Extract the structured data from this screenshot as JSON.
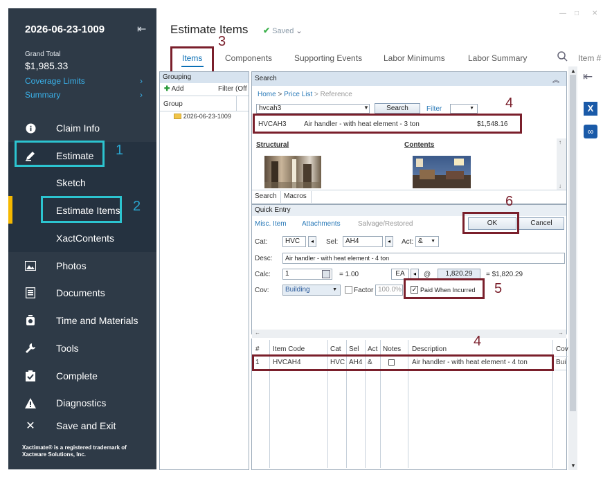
{
  "sidebar": {
    "title": "2026-06-23-1009",
    "grand_total_label": "Grand Total",
    "grand_total_value": "$1,985.33",
    "links": [
      "Coverage Limits",
      "Summary"
    ],
    "nav": [
      {
        "label": "Claim Info",
        "icon": "info-icon"
      },
      {
        "label": "Estimate",
        "icon": "pencil-icon"
      },
      {
        "label": "Sketch",
        "icon": ""
      },
      {
        "label": "Estimate Items",
        "icon": ""
      },
      {
        "label": "XactContents",
        "icon": ""
      },
      {
        "label": "Photos",
        "icon": "image-icon"
      },
      {
        "label": "Documents",
        "icon": "document-icon"
      },
      {
        "label": "Time and Materials",
        "icon": "stopwatch-icon"
      },
      {
        "label": "Tools",
        "icon": "wrench-icon"
      },
      {
        "label": "Complete",
        "icon": "clipboard-check-icon"
      },
      {
        "label": "Diagnostics",
        "icon": "warning-icon"
      },
      {
        "label": "Save and Exit",
        "icon": "close-icon"
      }
    ],
    "footer": "Xactimate® is a registered trademark of Xactware Solutions, Inc."
  },
  "header": {
    "title": "Estimate Items",
    "saved": "Saved",
    "tabs": [
      "Items",
      "Components",
      "Supporting Events",
      "Labor Minimums",
      "Labor Summary"
    ],
    "search_placeholder": "Item #"
  },
  "grouping": {
    "title": "Grouping",
    "add": "Add",
    "filter": "Filter (Off",
    "group_col": "Group",
    "group_item": "2026-06-23-1009"
  },
  "search": {
    "title": "Search",
    "breadcrumb_home": "Home",
    "breadcrumb_pricelist": "Price List",
    "breadcrumb_reference": "Reference",
    "query": "hvcah3",
    "search_btn": "Search",
    "filter_label": "Filter",
    "result_code": "HVCAH3",
    "result_desc": "Air handler - with heat element - 3 ton",
    "result_price": "$1,548.16",
    "structural": "Structural",
    "contents": "Contents",
    "tabs": [
      "Search",
      "Macros"
    ]
  },
  "quick_entry": {
    "title": "Quick Entry",
    "links": [
      "Misc. Item",
      "Attachments",
      "Salvage/Restored"
    ],
    "ok": "OK",
    "cancel": "Cancel",
    "cat_label": "Cat:",
    "cat_value": "HVC",
    "sel_label": "Sel:",
    "sel_value": "AH4",
    "act_label": "Act:",
    "act_value": "&",
    "desc_label": "Desc:",
    "desc_value": "Air handler - with heat element - 4 ton",
    "calc_label": "Calc:",
    "calc_value": "1",
    "qty": "= 1.00",
    "unit": "EA",
    "at": "@",
    "unit_price": "1,820.29",
    "total": "= $1,820.29",
    "cov_label": "Cov:",
    "cov_value": "Building",
    "factor_label": "Factor",
    "factor_value": "100.0%",
    "paid_label": "Paid When Incurred"
  },
  "grid": {
    "headers": [
      "#",
      "Item Code",
      "Cat",
      "Sel",
      "Act",
      "Notes",
      "Description",
      "Cov"
    ],
    "row": [
      "1",
      "HVCAH4",
      "HVC",
      "AH4",
      "&",
      "",
      "Air handler - with heat element - 4 ton",
      "Bui"
    ]
  },
  "annotations": {
    "red": [
      "3",
      "4",
      "6",
      "5",
      "4"
    ],
    "cyan": [
      "1",
      "2"
    ]
  },
  "colors": {
    "sidebar": "#2e3a47",
    "accent": "#f5b800",
    "link": "#3ab0e8",
    "annotation_red": "#7a1f2b",
    "annotation_cyan": "#2cc4d0"
  }
}
